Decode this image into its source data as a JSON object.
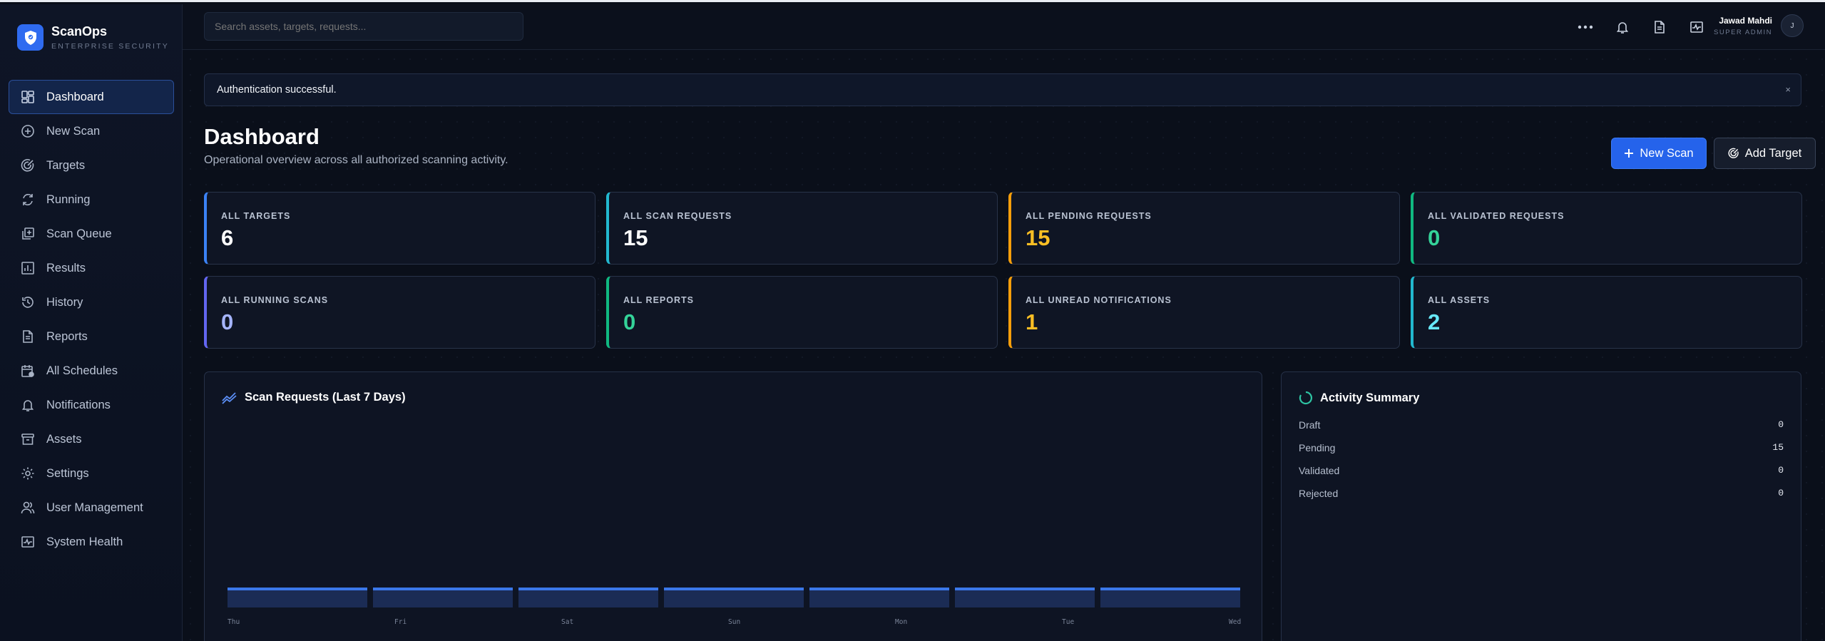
{
  "brand": {
    "name": "ScanOps",
    "subtitle": "ENTERPRISE SECURITY"
  },
  "sidebar": {
    "items": [
      {
        "label": "Dashboard",
        "icon": "dashboard-icon",
        "active": true
      },
      {
        "label": "New Scan",
        "icon": "plus-circle-icon"
      },
      {
        "label": "Targets",
        "icon": "target-icon"
      },
      {
        "label": "Running",
        "icon": "refresh-icon"
      },
      {
        "label": "Scan Queue",
        "icon": "queue-icon"
      },
      {
        "label": "Results",
        "icon": "bar-chart-icon"
      },
      {
        "label": "History",
        "icon": "history-icon"
      },
      {
        "label": "Reports",
        "icon": "document-icon"
      },
      {
        "label": "All Schedules",
        "icon": "calendar-icon"
      },
      {
        "label": "Notifications",
        "icon": "bell-icon"
      },
      {
        "label": "Assets",
        "icon": "archive-icon"
      },
      {
        "label": "Settings",
        "icon": "gear-icon"
      },
      {
        "label": "User Management",
        "icon": "users-icon"
      },
      {
        "label": "System Health",
        "icon": "health-icon"
      }
    ]
  },
  "topbar": {
    "search_placeholder": "Search assets, targets, requests...",
    "user_name": "Jawad Mahdi",
    "user_role": "SUPER ADMIN",
    "avatar_initial": "J"
  },
  "alert": {
    "message": "Authentication successful.",
    "close": "×"
  },
  "page": {
    "title": "Dashboard",
    "subtitle": "Operational overview across all authorized scanning activity.",
    "new_scan_label": "New Scan",
    "add_target_label": "Add Target"
  },
  "stats": [
    {
      "label": "ALL TARGETS",
      "value": "6",
      "accent": "#3b82f6",
      "value_color": "#ffffff"
    },
    {
      "label": "ALL SCAN REQUESTS",
      "value": "15",
      "accent": "#22b8cf",
      "value_color": "#ffffff"
    },
    {
      "label": "ALL PENDING REQUESTS",
      "value": "15",
      "accent": "#f59e0b",
      "value_color": "#fbbf24"
    },
    {
      "label": "ALL VALIDATED REQUESTS",
      "value": "0",
      "accent": "#10b981",
      "value_color": "#34d399"
    },
    {
      "label": "ALL RUNNING SCANS",
      "value": "0",
      "accent": "#6366f1",
      "value_color": "#a5b4fc"
    },
    {
      "label": "ALL REPORTS",
      "value": "0",
      "accent": "#10b981",
      "value_color": "#34d399"
    },
    {
      "label": "ALL UNREAD NOTIFICATIONS",
      "value": "1",
      "accent": "#f59e0b",
      "value_color": "#fbbf24"
    },
    {
      "label": "ALL ASSETS",
      "value": "2",
      "accent": "#22b8cf",
      "value_color": "#67e8f9"
    }
  ],
  "chart_panel": {
    "title": "Scan Requests (Last 7 Days)"
  },
  "chart_data": {
    "type": "bar",
    "title": "Scan Requests (Last 7 Days)",
    "categories": [
      "Thu",
      "Fri",
      "Sat",
      "Sun",
      "Mon",
      "Tue",
      "Wed"
    ],
    "values": [
      0,
      0,
      0,
      0,
      0,
      0,
      0
    ],
    "bar_color": "#3b78ea",
    "grid": false
  },
  "activity": {
    "title": "Activity Summary",
    "rows": [
      {
        "label": "Draft",
        "value": "0"
      },
      {
        "label": "Pending",
        "value": "15"
      },
      {
        "label": "Validated",
        "value": "0"
      },
      {
        "label": "Rejected",
        "value": "0"
      }
    ]
  }
}
